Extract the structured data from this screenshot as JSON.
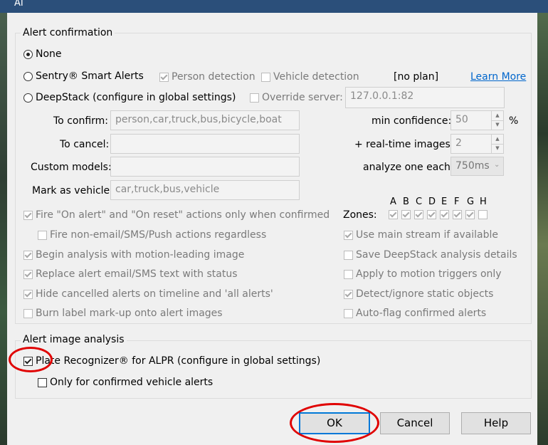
{
  "window": {
    "title": "AI"
  },
  "alert_confirmation": {
    "legend": "Alert confirmation",
    "none_label": "None",
    "sentry_label": "Sentry® Smart Alerts",
    "person_detection": "Person detection",
    "vehicle_detection": "Vehicle detection",
    "plan_status": "[no plan]",
    "learn_more": "Learn More",
    "deepstack_label": "DeepStack (configure in global settings)",
    "override_server_label": "Override server:",
    "override_server_value": "127.0.0.1:82",
    "to_confirm_label": "To confirm:",
    "to_confirm_value": "person,car,truck,bus,bicycle,boat",
    "to_cancel_label": "To cancel:",
    "to_cancel_value": "",
    "custom_models_label": "Custom models:",
    "custom_models_value": "",
    "mark_vehicle_label": "Mark as vehicle:",
    "mark_vehicle_value": "car,truck,bus,vehicle",
    "min_confidence_label": "min confidence:",
    "min_confidence_value": "50",
    "min_confidence_unit": "%",
    "realtime_label": "+ real-time images:",
    "realtime_value": "2",
    "analyze_label": "analyze one each:",
    "analyze_value": "750ms",
    "zones_label": "Zones:",
    "zones": [
      {
        "letter": "A",
        "checked": true
      },
      {
        "letter": "B",
        "checked": true
      },
      {
        "letter": "C",
        "checked": true
      },
      {
        "letter": "D",
        "checked": true
      },
      {
        "letter": "E",
        "checked": true
      },
      {
        "letter": "F",
        "checked": true
      },
      {
        "letter": "G",
        "checked": true
      },
      {
        "letter": "H",
        "checked": false
      }
    ],
    "options_left": [
      {
        "label": "Fire \"On alert\" and \"On reset\" actions only when confirmed",
        "checked": true
      },
      {
        "label": "Fire non-email/SMS/Push actions regardless",
        "checked": false
      },
      {
        "label": "Begin analysis with motion-leading image",
        "checked": true
      },
      {
        "label": "Replace alert email/SMS text with status",
        "checked": true
      },
      {
        "label": "Hide cancelled alerts on timeline and  'all alerts'",
        "checked": true
      },
      {
        "label": "Burn label mark-up onto alert images",
        "checked": false
      }
    ],
    "options_right": [
      {
        "label": "Use main stream if available",
        "checked": true
      },
      {
        "label": "Save DeepStack analysis details",
        "checked": false
      },
      {
        "label": "Apply to motion triggers only",
        "checked": false
      },
      {
        "label": "Detect/ignore static objects",
        "checked": true
      },
      {
        "label": "Auto-flag confirmed alerts",
        "checked": false
      }
    ]
  },
  "image_analysis": {
    "legend": "Alert image analysis",
    "plate_label": "Plate Recognizer® for ALPR (configure in global settings)",
    "plate_checked": true,
    "only_confirmed_label": "Only for confirmed vehicle alerts",
    "only_confirmed_checked": false
  },
  "buttons": {
    "ok": "OK",
    "cancel": "Cancel",
    "help": "Help"
  },
  "colors": {
    "annotation": "#e00000",
    "link": "#0066cc",
    "title_bar": "#2b4f7a"
  }
}
